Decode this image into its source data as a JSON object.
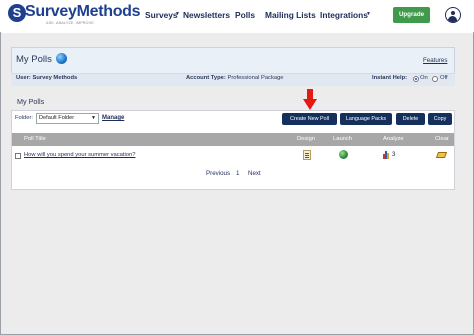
{
  "brand": {
    "logo_letter": "S",
    "name": "SurveyMethods",
    "tagline": "ASK. ANALYZE. IMPROVE."
  },
  "nav": {
    "items": [
      "Surveys",
      "Newsletters",
      "Polls",
      "Mailing Lists",
      "Integrations"
    ],
    "upgrade_label": "Upgrade"
  },
  "panel": {
    "title": "My Polls",
    "features_link": "Features",
    "user_label": "User:",
    "user_value": "Survey Methods",
    "account_label": "Account Type:",
    "account_value": "Professional Package",
    "instant_help_label": "Instant Help:",
    "on_label": "On",
    "off_label": "Off"
  },
  "section_title": "My Polls",
  "toolbar": {
    "folder_label": "Folder:",
    "folder_value": "Default Folder",
    "manage_label": "Manage",
    "buttons": [
      "Create New Poll",
      "Language Packs",
      "Delete",
      "Copy"
    ]
  },
  "table": {
    "headers": [
      "Poll Title",
      "Design",
      "Launch",
      "Analyze",
      "Clear"
    ],
    "rows": [
      {
        "title": "How will you spend your summer vacation?",
        "analyze_count": "3"
      }
    ]
  },
  "pager": {
    "previous": "Previous",
    "page": "1",
    "next": "Next"
  },
  "colors": {
    "brand": "#1f3f8f",
    "upgrade": "#3f9b4b",
    "button": "#16305e",
    "table_header": "#a7a7a7",
    "highlight_arrow": "#e31b12"
  },
  "icons": {
    "design": "document-edit-icon",
    "launch": "globe-icon",
    "analyze": "bar-chart-icon",
    "clear": "eraser-icon"
  }
}
